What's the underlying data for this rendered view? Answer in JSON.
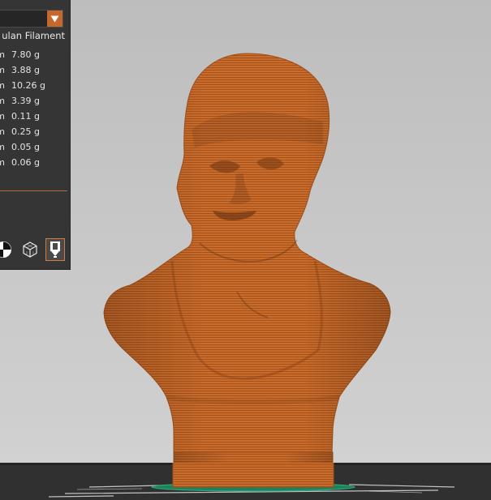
{
  "material": {
    "name": "ulan Filament"
  },
  "usage": [
    {
      "unit": "m",
      "weight": "7.80 g"
    },
    {
      "unit": "m",
      "weight": "3.88 g"
    },
    {
      "unit": "m",
      "weight": "10.26 g"
    },
    {
      "unit": "m",
      "weight": "3.39 g"
    },
    {
      "unit": "m",
      "weight": "0.11 g"
    },
    {
      "unit": "m",
      "weight": "0.25 g"
    },
    {
      "unit": "m",
      "weight": "0.05 g"
    },
    {
      "unit": "m",
      "weight": "0.06 g"
    }
  ],
  "toolbar": {
    "buttons": [
      {
        "name": "xray-view",
        "icon": "xray-view-icon"
      },
      {
        "name": "solid-view",
        "icon": "wireframe-cube-icon"
      },
      {
        "name": "layer-view",
        "icon": "layer-view-icon",
        "active": true
      }
    ]
  },
  "colors": {
    "accent": "#c8672b",
    "model": "#c76a2a",
    "panel": "#353535",
    "bed_outline": "#1f8a62"
  }
}
